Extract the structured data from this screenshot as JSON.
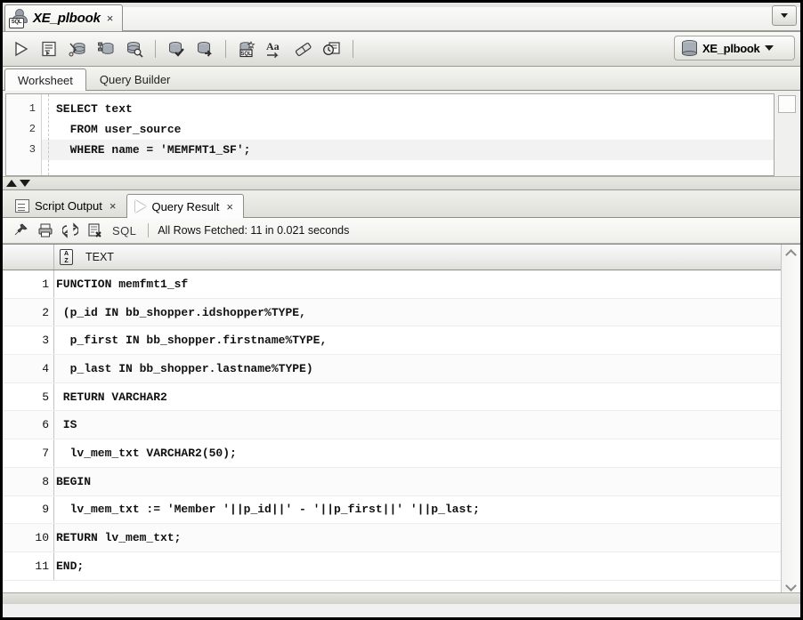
{
  "window": {
    "doc_tab": {
      "title": "XE_plbook",
      "icon": "sql-database-icon",
      "close_label": "×"
    },
    "tabstrip_menu_icon": "chevron-down-icon"
  },
  "toolbar": {
    "buttons": [
      {
        "name": "run-statement-button",
        "icon": "run-triangle-icon",
        "title": "Run Statement"
      },
      {
        "name": "run-script-button",
        "icon": "run-script-icon",
        "title": "Run Script"
      },
      {
        "name": "autotrace-button",
        "icon": "autotrace-icon",
        "title": "Autotrace"
      },
      {
        "name": "explain-plan-button",
        "icon": "explain-plan-icon",
        "title": "Explain Plan"
      },
      {
        "name": "sql-tuning-button",
        "icon": "database-search-icon",
        "title": "SQL Tuning Advisor"
      },
      {
        "name": "commit-button",
        "icon": "database-check-icon",
        "title": "Commit"
      },
      {
        "name": "rollback-button",
        "icon": "database-rollback-icon",
        "title": "Rollback"
      },
      {
        "name": "sqlplus-button",
        "icon": "sql-star-icon",
        "title": "Run SQL*Plus"
      },
      {
        "name": "format-button",
        "icon": "aa-format-icon",
        "title": "Format"
      },
      {
        "name": "clear-button",
        "icon": "eraser-icon",
        "title": "Clear"
      },
      {
        "name": "history-button",
        "icon": "clock-history-icon",
        "title": "SQL History"
      }
    ],
    "connection": {
      "name": "XE_plbook",
      "icon": "database-cylinder-icon",
      "caret": "chevron-down-icon"
    }
  },
  "worksheet_tabs": [
    {
      "label": "Worksheet",
      "active": true
    },
    {
      "label": "Query Builder",
      "active": false
    }
  ],
  "editor": {
    "lines": [
      {
        "num": "1",
        "text": "SELECT text",
        "highlight": false
      },
      {
        "num": "2",
        "text": "  FROM user_source",
        "highlight": false
      },
      {
        "num": "3",
        "text": "  WHERE name = 'MEMFMT1_SF';",
        "highlight": true
      }
    ],
    "side_button": "code-outline-toggle"
  },
  "splitter": {
    "up_icon": "triangle-up-icon",
    "down_icon": "triangle-down-icon"
  },
  "result_tabs": [
    {
      "label": "Script Output",
      "icon": "script-output-icon",
      "close_label": "×",
      "active": false
    },
    {
      "label": "Query Result",
      "icon": "run-triangle-icon",
      "close_label": "×",
      "active": true
    }
  ],
  "result_toolbar": {
    "buttons": [
      {
        "name": "pin-button",
        "icon": "pin-icon",
        "title": "Freeze / Pin"
      },
      {
        "name": "print-button",
        "icon": "printer-icon",
        "title": "Print"
      },
      {
        "name": "refresh-button",
        "icon": "refresh-arrows-icon",
        "title": "Refresh"
      },
      {
        "name": "clear-results-button",
        "icon": "document-delete-icon",
        "title": "Clear Results"
      }
    ],
    "sql_label": "SQL",
    "status": "All Rows Fetched: 11 in 0.021 seconds"
  },
  "grid": {
    "columns": [
      {
        "label": "TEXT",
        "sort_icon": "az-sort-icon"
      }
    ],
    "rows": [
      {
        "num": "1",
        "text": "FUNCTION memfmt1_sf"
      },
      {
        "num": "2",
        "text": " (p_id IN bb_shopper.idshopper%TYPE,"
      },
      {
        "num": "3",
        "text": "  p_first IN bb_shopper.firstname%TYPE,"
      },
      {
        "num": "4",
        "text": "  p_last IN bb_shopper.lastname%TYPE)"
      },
      {
        "num": "5",
        "text": " RETURN VARCHAR2"
      },
      {
        "num": "6",
        "text": " IS"
      },
      {
        "num": "7",
        "text": "  lv_mem_txt VARCHAR2(50);"
      },
      {
        "num": "8",
        "text": "BEGIN"
      },
      {
        "num": "9",
        "text": "  lv_mem_txt := 'Member '||p_id||' - '||p_first||' '||p_last;"
      },
      {
        "num": "10",
        "text": "RETURN lv_mem_txt;"
      },
      {
        "num": "11",
        "text": "END;"
      }
    ]
  },
  "scrollbar": {
    "up_icon": "chevron-up-icon",
    "down_icon": "chevron-down-icon"
  }
}
